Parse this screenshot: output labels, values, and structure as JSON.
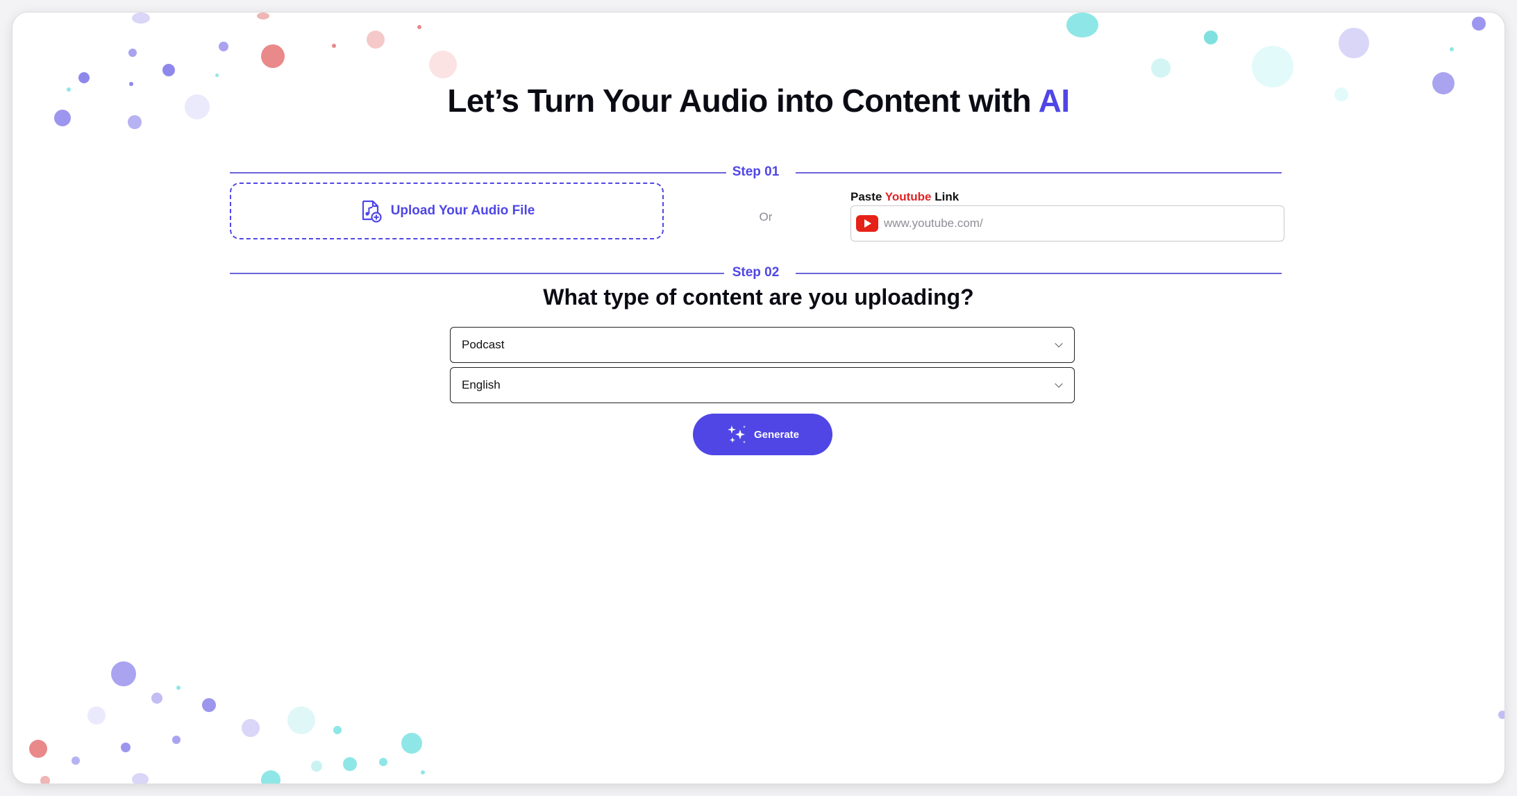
{
  "header": {
    "title_prefix": "Let’s Turn Your Audio into Content with ",
    "title_accent": "AI"
  },
  "step1": {
    "label": "Step 01",
    "upload_label": "Upload Your Audio File",
    "or_text": "Or",
    "youtube": {
      "caption_prefix": "Paste ",
      "caption_accent": "Youtube",
      "caption_suffix": " Link",
      "placeholder": "www.youtube.com/",
      "value": ""
    }
  },
  "step2": {
    "label": "Step 02",
    "question": "What type of content are you uploading?",
    "content_type": {
      "selected": "Podcast"
    },
    "language": {
      "selected": "English"
    },
    "generate_label": "Generate"
  },
  "colors": {
    "accent": "#4f46e5",
    "youtube_red": "#e02424",
    "text": "#0b0b14"
  }
}
